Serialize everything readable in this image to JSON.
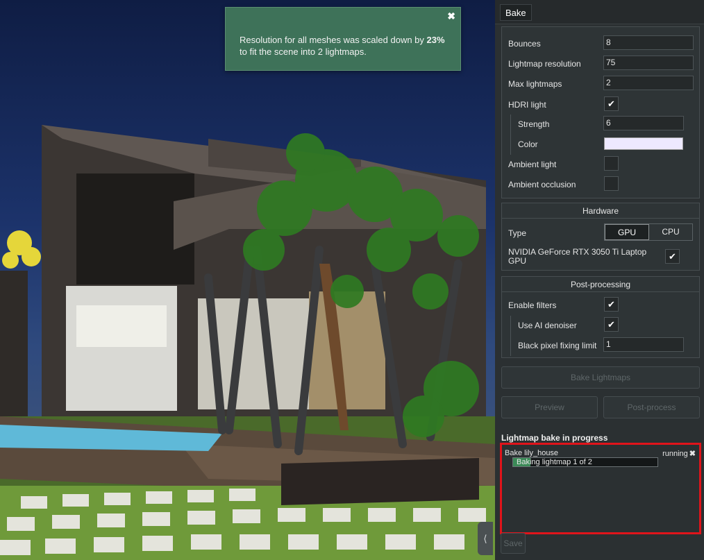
{
  "toast": {
    "text_before": "Resolution for all meshes was scaled down by ",
    "percent": "23%",
    "text_after": " to fit the scene into 2 lightmaps.",
    "close": "✖"
  },
  "viewport": {
    "collapse_icon": "⟨",
    "collapse_icon_name": "chevron-left-icon"
  },
  "tabs": {
    "bake": "Bake"
  },
  "settings": {
    "bounces": {
      "label": "Bounces",
      "value": "8"
    },
    "lightmap_resolution": {
      "label": "Lightmap resolution",
      "value": "75"
    },
    "max_lightmaps": {
      "label": "Max lightmaps",
      "value": "2"
    },
    "hdri_light": {
      "label": "HDRI light",
      "checked": "✔"
    },
    "strength": {
      "label": "Strength",
      "value": "6"
    },
    "color": {
      "label": "Color",
      "swatch": "#eee9ff"
    },
    "ambient_light": {
      "label": "Ambient light",
      "checked": ""
    },
    "ambient_occlusion": {
      "label": "Ambient occlusion",
      "checked": ""
    }
  },
  "hardware": {
    "title": "Hardware",
    "type_label": "Type",
    "options": [
      "GPU",
      "CPU"
    ],
    "selected": "GPU",
    "device_label": "NVIDIA GeForce RTX 3050 Ti Laptop GPU",
    "device_checked": "✔"
  },
  "post_processing": {
    "title": "Post-processing",
    "enable_filters": {
      "label": "Enable filters",
      "checked": "✔"
    },
    "ai_denoiser": {
      "label": "Use AI denoiser",
      "checked": "✔"
    },
    "black_pixel": {
      "label": "Black pixel fixing limit",
      "value": "1"
    }
  },
  "actions": {
    "bake": "Bake Lightmaps",
    "preview": "Preview",
    "post_process": "Post-process"
  },
  "progress": {
    "title": "Lightmap bake in progress",
    "job_name": "Bake lily_house",
    "status": "running",
    "cancel": "✖",
    "bar_text": "Baking lightmap 1 of 2",
    "fraction": 0.12
  },
  "footer": {
    "save": "Save"
  },
  "colors": {
    "accent_green": "#3e7259",
    "highlight_red": "#e0141b",
    "progress_fill": "#3b8a57"
  }
}
